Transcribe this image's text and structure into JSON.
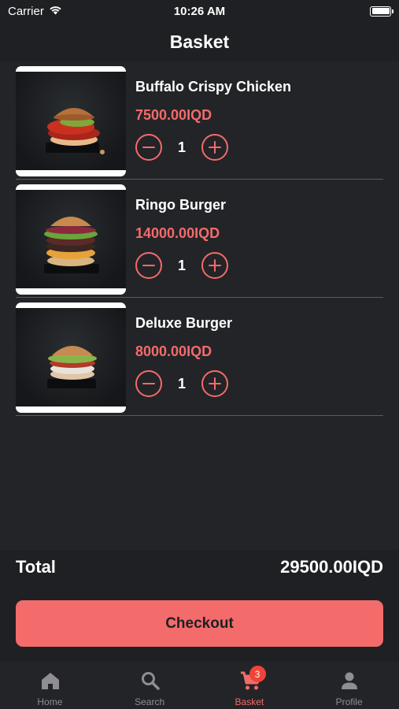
{
  "status_bar": {
    "carrier": "Carrier",
    "time": "10:26 AM"
  },
  "header": {
    "title": "Basket"
  },
  "items": [
    {
      "name": "Buffalo Crispy Chicken",
      "price": "7500.00IQD",
      "quantity": "1",
      "image": "burger-photo"
    },
    {
      "name": "Ringo Burger",
      "price": "14000.00IQD",
      "quantity": "1",
      "image": "burger-photo"
    },
    {
      "name": "Deluxe Burger",
      "price": "8000.00IQD",
      "quantity": "1",
      "image": "burger-photo"
    }
  ],
  "total": {
    "label": "Total",
    "value": "29500.00IQD"
  },
  "checkout": {
    "label": "Checkout"
  },
  "tabs": [
    {
      "label": "Home",
      "icon": "home-icon"
    },
    {
      "label": "Search",
      "icon": "search-icon"
    },
    {
      "label": "Basket",
      "icon": "cart-icon",
      "badge": "3",
      "active": true
    },
    {
      "label": "Profile",
      "icon": "person-icon"
    }
  ],
  "colors": {
    "accent": "#f36b6b",
    "background": "#1f2023",
    "surface": "#232427",
    "inactive": "#8e8e93",
    "badge": "#f04438"
  }
}
